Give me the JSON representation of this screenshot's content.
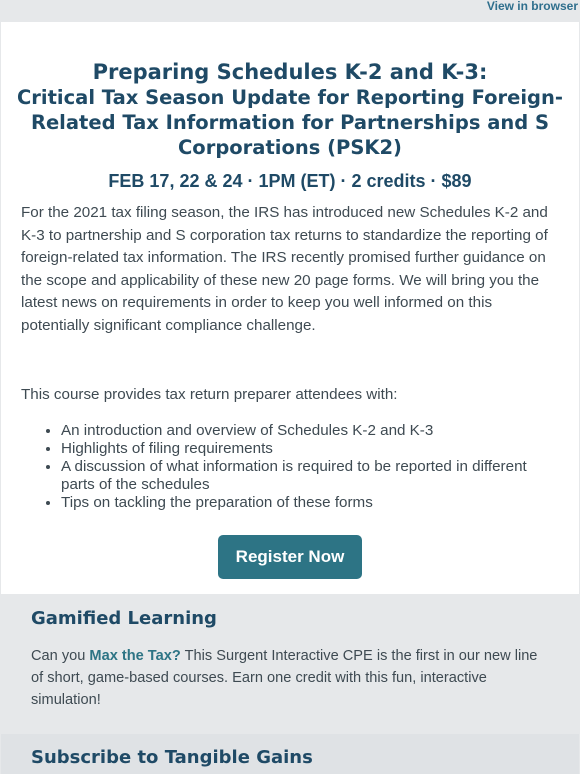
{
  "header": {
    "view_in_browser": "View in browser"
  },
  "course": {
    "title_line1": "Preparing Schedules K-2 and K-3:",
    "title_line2": "Critical Tax Season Update for Reporting Foreign-Related Tax Information for Partnerships and S Corporations (PSK2)",
    "date_line": "FEB 17, 22 & 24 · 1PM (ET) · 2 credits · $89",
    "intro": "For the 2021 tax filing season, the IRS has introduced new Schedules K-2 and K-3 to partnership and S corporation tax returns to standardize the reporting of foreign-related tax information. The IRS recently promised further guidance on the scope and applicability of these new 20 page forms. We will bring you the latest news on requirements in order to keep you well informed on this potentially significant compliance challenge.",
    "lead": "This course provides tax return preparer attendees with:",
    "bullets": [
      "An introduction and overview of Schedules K-2 and K-3",
      "Highlights of filing requirements",
      "A discussion of what information is required to be reported in different parts of the schedules",
      "Tips on tackling the preparation of these forms"
    ],
    "register_label": "Register Now"
  },
  "gamified": {
    "heading": "Gamified Learning",
    "text_before": "Can you ",
    "link": "Max the Tax?",
    "text_after": " This Surgent Interactive CPE is the first in our new line of short, game-based courses. Earn one credit with this fun, interactive simulation!"
  },
  "subscribe": {
    "heading": "Subscribe to Tangible Gains"
  },
  "colors": {
    "accent": "#2d7485",
    "heading": "#1f4a66",
    "body_text": "#3e4a52",
    "background": "#e6e8ea"
  }
}
